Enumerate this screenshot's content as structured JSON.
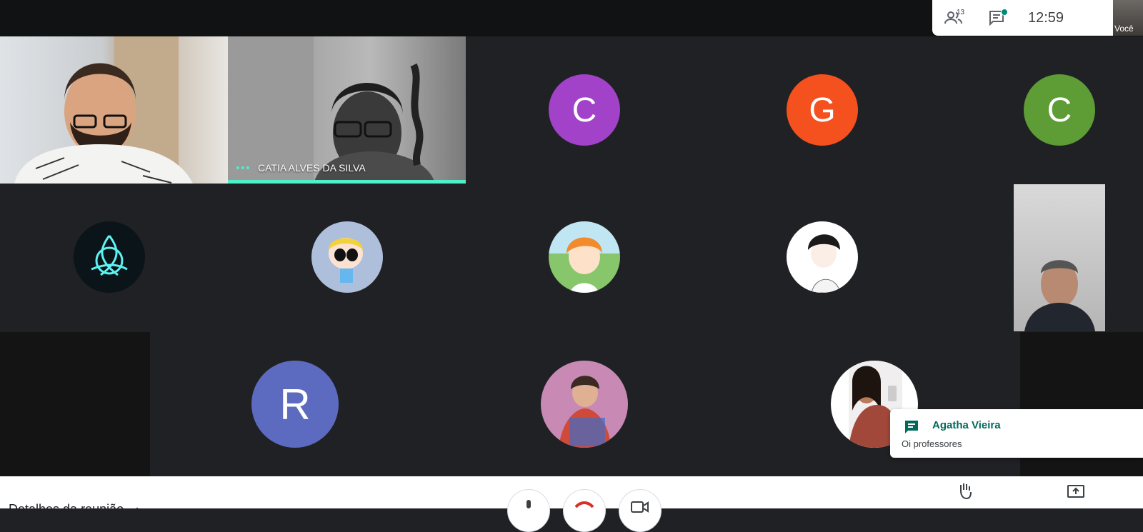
{
  "header": {
    "participants_count": "13",
    "clock": "12:59",
    "self_label": "Você"
  },
  "tiles": {
    "speaker_name": "CATIA ALVES DA SILVA",
    "letters": [
      "C",
      "G",
      "C",
      "R"
    ],
    "colors": {
      "letter_c1": "#a142c9",
      "letter_g": "#f4511e",
      "letter_c2": "#5e9c36",
      "letter_r": "#5c6bc0",
      "speaking": "#4df0c8"
    }
  },
  "toast": {
    "name": "Agatha Vieira",
    "message": "Oi professores"
  },
  "bottom": {
    "details": "Detalhes da reunião"
  }
}
